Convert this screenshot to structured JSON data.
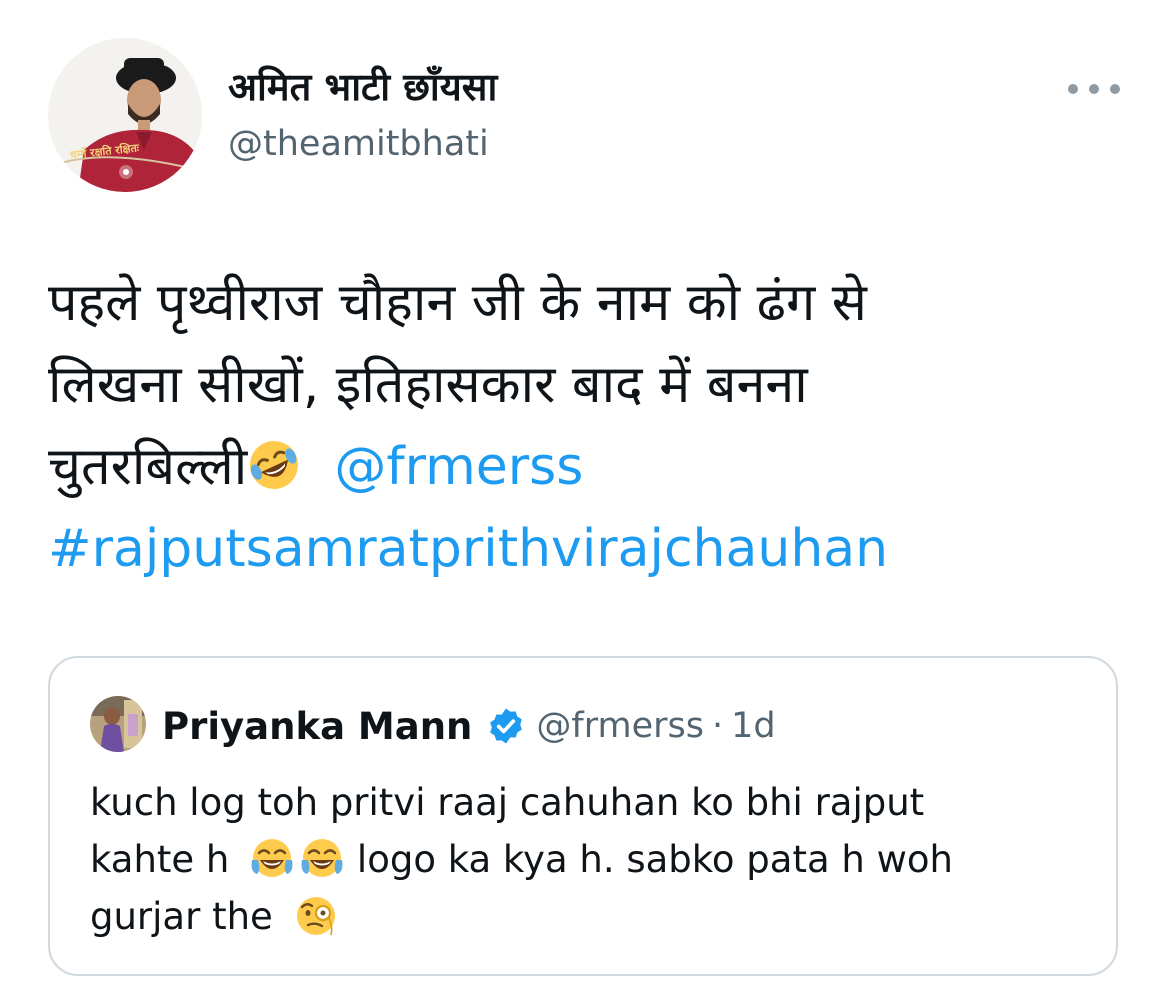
{
  "author": {
    "display_name": "अमित भाटी छाँयसा",
    "handle": "@theamitbhati",
    "avatar_banner_text": "धर्मो रक्षति रक्षितः"
  },
  "menu": {
    "icon": "more-horizontal-icon"
  },
  "tweet": {
    "line1": "पहले पृथ्वीराज चौहान जी के नाम को ढंग से",
    "line2": "लिखना सीखों, इतिहासकार बाद में बनना",
    "line3": "चुतरबिल्ली",
    "emoji": "rolling-on-floor-laughing-emoji",
    "mention": "@frmerss",
    "hashtag": "#rajputsamratprithvirajchauhan"
  },
  "quoted_tweet": {
    "name": "Priyanka Mann",
    "verified_icon": "verified-badge-icon",
    "handle": "@frmerss",
    "dot": "·",
    "time": "1d",
    "text_part1": "kuch log toh pritvi raaj cahuhan ko bhi rajput",
    "text_part2": "kahte h",
    "emoji_a": "face-with-tears-of-joy-emoji",
    "text_part3": "logo ka kya h. sabko pata h woh",
    "text_part4": "gurjar the",
    "emoji_b": "face-with-monocle-emoji"
  },
  "colors": {
    "link": "#1d9bf0",
    "text": "#0f1419",
    "secondary": "#536471",
    "border": "#cfd9de"
  }
}
